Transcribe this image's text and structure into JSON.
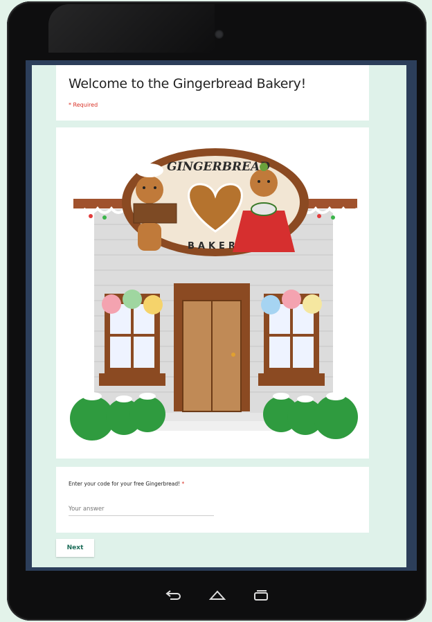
{
  "form": {
    "title": "Welcome to the Gingerbread Bakery!",
    "required_note": "* Required",
    "image": {
      "sign_top": "GINGERBREAD",
      "sign_bottom": "BAKERY"
    },
    "question": {
      "label": "Enter your code for your free Gingerbread!",
      "required_star": "*",
      "placeholder": "Your answer"
    },
    "next_label": "Next"
  },
  "nav": {
    "icons": [
      "back-icon",
      "home-icon",
      "recents-icon"
    ]
  },
  "colors": {
    "background": "#e3f3ea",
    "tablet": "#0e0e0f",
    "screen_frame": "#2c3e5a",
    "form_background": "#dff2ea",
    "required": "#d93025",
    "next_text": "#1a6b57"
  }
}
